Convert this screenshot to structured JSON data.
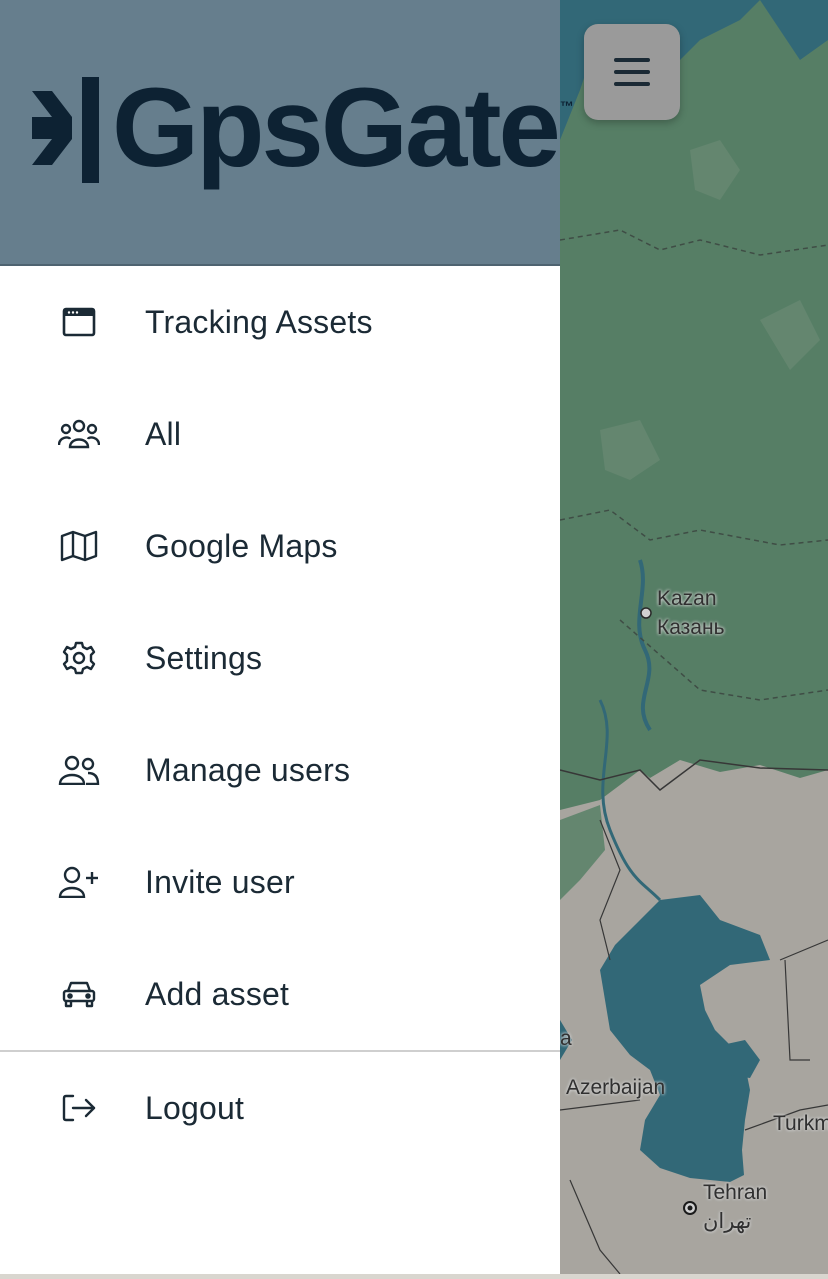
{
  "header": {
    "logo_text": "GpsGate",
    "logo_tm": "™"
  },
  "menu": {
    "items": [
      {
        "label": "Tracking Assets",
        "icon": "browser-window-icon"
      },
      {
        "label": "All",
        "icon": "users-group-icon"
      },
      {
        "label": "Google Maps",
        "icon": "map-icon"
      },
      {
        "label": "Settings",
        "icon": "gear-icon"
      },
      {
        "label": "Manage users",
        "icon": "users-icon"
      },
      {
        "label": "Invite user",
        "icon": "user-plus-icon"
      },
      {
        "label": "Add asset",
        "icon": "car-icon"
      }
    ],
    "logout": {
      "label": "Logout",
      "icon": "logout-icon"
    }
  },
  "map": {
    "labels": {
      "kazan_en": "Kazan",
      "kazan_ru": "Казань",
      "azerbaijan_partial_left": "a",
      "azerbaijan": "Azerbaijan",
      "turkmenistan_partial": "Turkm",
      "tehran_en": "Tehran",
      "tehran_fa": "تهران"
    }
  },
  "colors": {
    "header_bg": "#667e8d",
    "logo": "#0d2233",
    "text": "#1b2a35",
    "map_land_green": "#6a9a7c",
    "map_water": "#3d7f92"
  }
}
